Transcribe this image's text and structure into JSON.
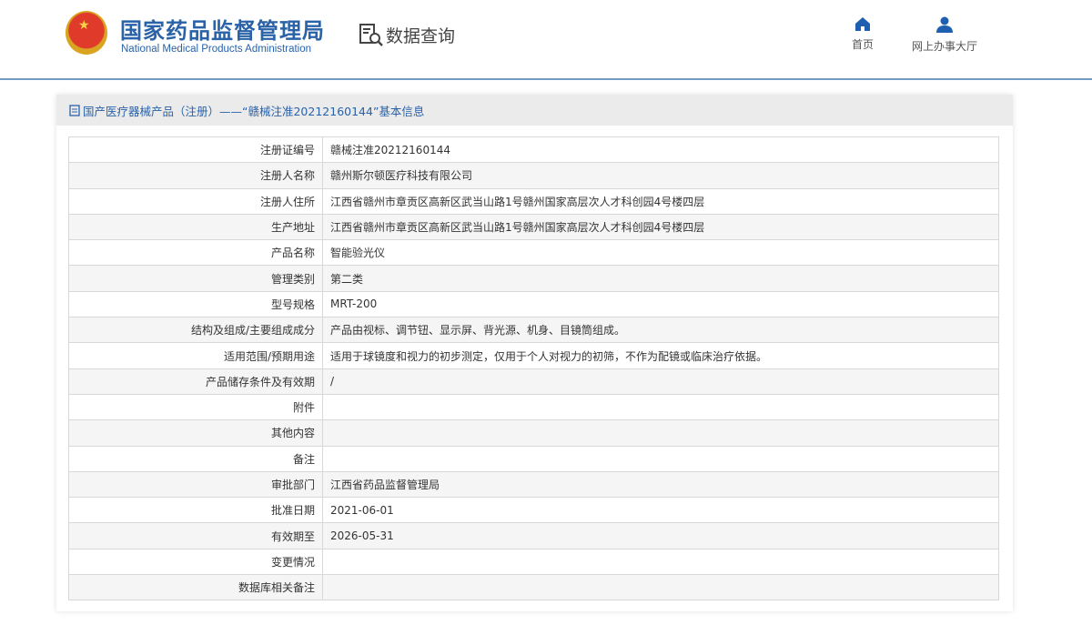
{
  "header": {
    "title_cn": "国家药品监督管理局",
    "title_en": "National Medical Products Administration",
    "query_label": "数据查询",
    "nav": [
      {
        "label": "首页"
      },
      {
        "label": "网上办事大厅"
      }
    ]
  },
  "panel": {
    "title": "国产医疗器械产品（注册）——“赣械注准20212160144”基本信息"
  },
  "rows": [
    {
      "k": "注册证编号",
      "v": "赣械注准20212160144"
    },
    {
      "k": "注册人名称",
      "v": "赣州斯尔顿医疗科技有限公司"
    },
    {
      "k": "注册人住所",
      "v": "江西省赣州市章贡区高新区武当山路1号赣州国家高层次人才科创园4号楼四层"
    },
    {
      "k": "生产地址",
      "v": "江西省赣州市章贡区高新区武当山路1号赣州国家高层次人才科创园4号楼四层"
    },
    {
      "k": "产品名称",
      "v": "智能验光仪"
    },
    {
      "k": "管理类别",
      "v": "第二类"
    },
    {
      "k": "型号规格",
      "v": "MRT-200"
    },
    {
      "k": "结构及组成/主要组成成分",
      "v": "产品由视标、调节钮、显示屏、背光源、机身、目镜筒组成。"
    },
    {
      "k": "适用范围/预期用途",
      "v": "适用于球镜度和视力的初步测定，仅用于个人对视力的初筛，不作为配镜或临床治疗依据。"
    },
    {
      "k": "产品储存条件及有效期",
      "v": "/"
    },
    {
      "k": "附件",
      "v": ""
    },
    {
      "k": "其他内容",
      "v": ""
    },
    {
      "k": "备注",
      "v": ""
    },
    {
      "k": "审批部门",
      "v": "江西省药品监督管理局"
    },
    {
      "k": "批准日期",
      "v": "2021-06-01"
    },
    {
      "k": "有效期至",
      "v": "2026-05-31"
    },
    {
      "k": "变更情况",
      "v": ""
    },
    {
      "k": "数据库相关备注",
      "v": ""
    }
  ]
}
